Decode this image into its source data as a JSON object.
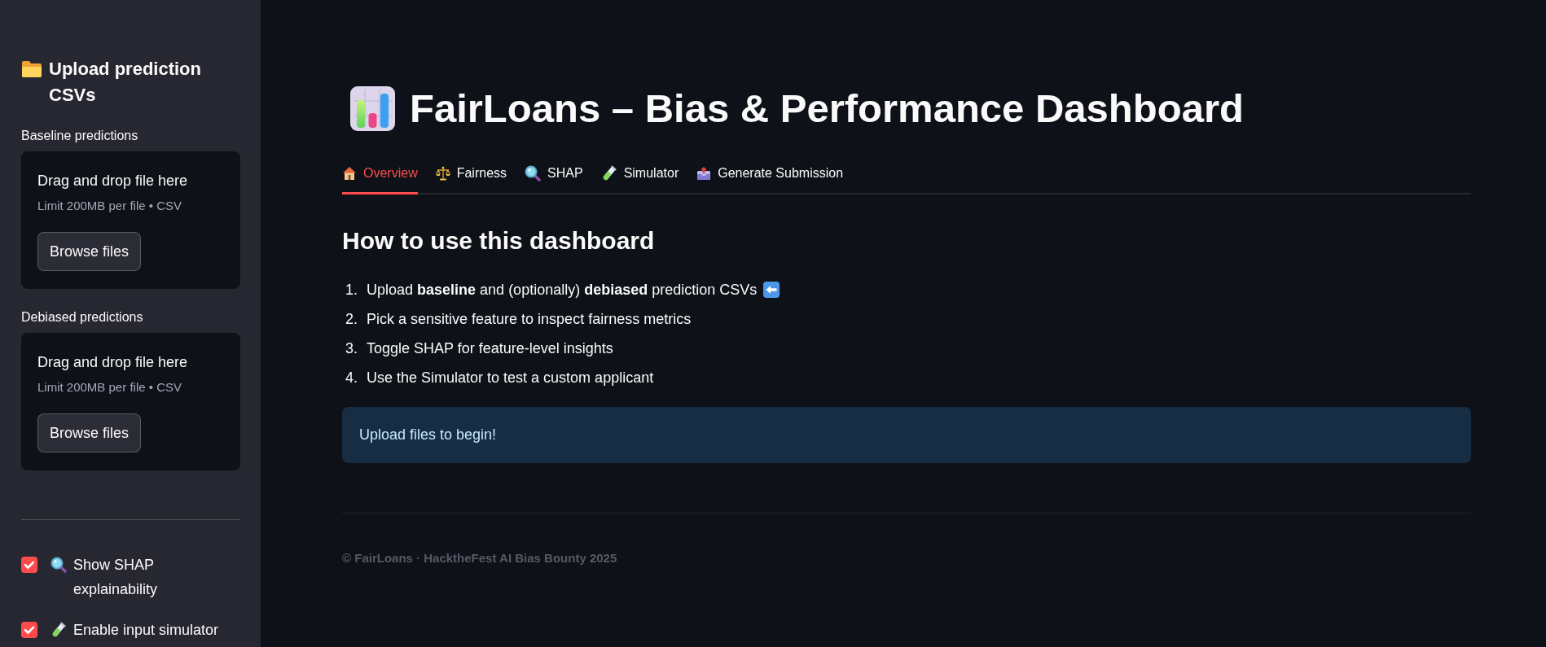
{
  "sidebar": {
    "title": "Upload prediction CSVs",
    "uploaders": [
      {
        "label": "Baseline predictions",
        "prompt": "Drag and drop file here",
        "limit": "Limit 200MB per file • CSV",
        "button": "Browse files"
      },
      {
        "label": "Debiased predictions",
        "prompt": "Drag and drop file here",
        "limit": "Limit 200MB per file • CSV",
        "button": "Browse files"
      }
    ],
    "options": [
      {
        "label": "Show SHAP explainability",
        "checked": true
      },
      {
        "label": "Enable input simulator",
        "checked": true
      }
    ]
  },
  "main": {
    "title": "FairLoans – Bias & Performance Dashboard",
    "tabs": [
      {
        "label": "Overview",
        "selected": true
      },
      {
        "label": "Fairness",
        "selected": false
      },
      {
        "label": "SHAP",
        "selected": false
      },
      {
        "label": "Simulator",
        "selected": false
      },
      {
        "label": "Generate Submission",
        "selected": false
      }
    ],
    "section_title": "How to use this dashboard",
    "steps": [
      {
        "number": "1.",
        "text": "Upload **baseline** and (optionally) **debiased** prediction CSVs",
        "kind": "pointer"
      },
      {
        "number": "2.",
        "text": "Pick a sensitive feature to inspect fairness metrics",
        "kind": "plain"
      },
      {
        "number": "3.",
        "text": "Toggle SHAP for feature-level insights",
        "kind": "plain"
      },
      {
        "number": "4.",
        "text": "Use the Simulator to test a custom applicant",
        "kind": "plain"
      }
    ],
    "info": "Upload files to begin!",
    "footer": "© FairLoans · HacktheFest AI Bias Bounty 2025"
  }
}
